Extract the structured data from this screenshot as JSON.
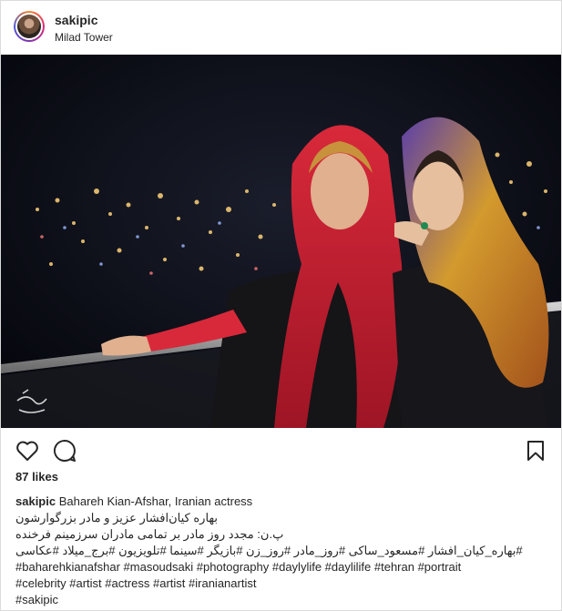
{
  "post": {
    "username": "sakipic",
    "location": "Milad Tower",
    "likes": "87 likes",
    "caption_user": "sakipic",
    "caption_text": "Bahareh Kian-Afshar, Iranian actress",
    "lines": [
      "بهاره کیان‌افشار عزیز و مادر بزرگوارشون",
      "پ.ن: مجدد روز مادر بر تمامی مادران سرزمینم فرخنده",
      "#بهاره_کیان_افشار #مسعود_ساکی #روز_مادر #روز_زن #بازیگر #سینما #تلویزیون #برج_میلاد #عکاسی",
      "#baharehkianafshar #masoudsaki #photography #daylylife #daylilife #tehran #portrait",
      "#celebrity #artist #actress #artist #iranianartist",
      "#sakipic"
    ]
  },
  "icons": {
    "like": "heart-icon",
    "comment": "comment-icon",
    "save": "bookmark-icon"
  },
  "colors": {
    "text": "#262626",
    "hashtag": "#003569",
    "border": "#dbdbdb"
  }
}
